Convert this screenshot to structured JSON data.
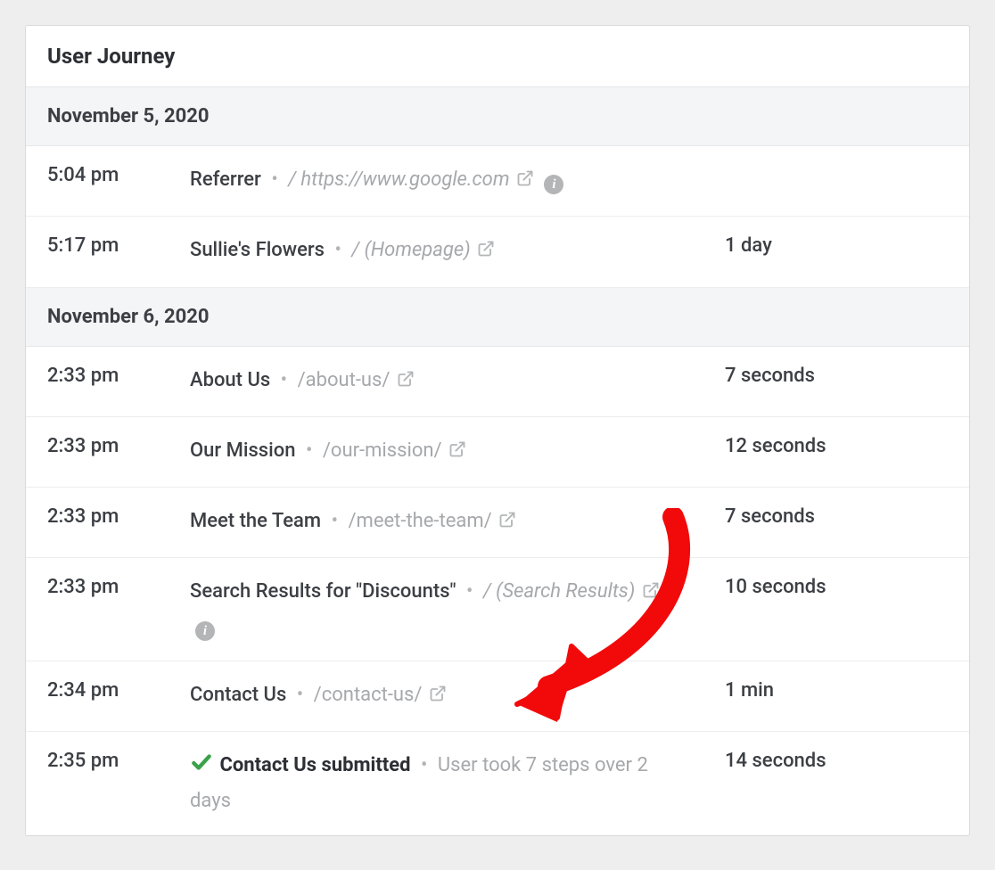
{
  "panel": {
    "title": "User Journey"
  },
  "groups": [
    {
      "date": "November 5, 2020",
      "rows": [
        {
          "time": "5:04 pm",
          "title": "Referrer",
          "path": "/ https://www.google.com",
          "pathItalic": true,
          "ext": true,
          "info": true,
          "duration": ""
        },
        {
          "time": "5:17 pm",
          "title": "Sullie's Flowers",
          "path": "/ (Homepage)",
          "pathItalic": true,
          "ext": true,
          "info": false,
          "duration": "1 day"
        }
      ]
    },
    {
      "date": "November 6, 2020",
      "rows": [
        {
          "time": "2:33 pm",
          "title": "About Us",
          "path": "/about-us/",
          "pathItalic": false,
          "ext": true,
          "info": false,
          "duration": "7 seconds"
        },
        {
          "time": "2:33 pm",
          "title": "Our Mission",
          "path": "/our-mission/",
          "pathItalic": false,
          "ext": true,
          "info": false,
          "duration": "12 seconds"
        },
        {
          "time": "2:33 pm",
          "title": "Meet the Team",
          "path": "/meet-the-team/",
          "pathItalic": false,
          "ext": true,
          "info": false,
          "duration": "7 seconds"
        },
        {
          "time": "2:33 pm",
          "title": "Search Results for \"Discounts\"",
          "path": "/ (Search Results)",
          "pathItalic": true,
          "ext": true,
          "info": true,
          "duration": "10 seconds"
        },
        {
          "time": "2:34 pm",
          "title": "Contact Us",
          "path": "/contact-us/",
          "pathItalic": false,
          "ext": true,
          "info": false,
          "duration": "1 min"
        },
        {
          "time": "2:35 pm",
          "title": "Contact Us submitted",
          "summary": "User took 7 steps over 2 days",
          "check": true,
          "duration": "14 seconds"
        }
      ]
    }
  ],
  "colors": {
    "arrow": "#f20a0a",
    "check": "#3aa24a"
  }
}
